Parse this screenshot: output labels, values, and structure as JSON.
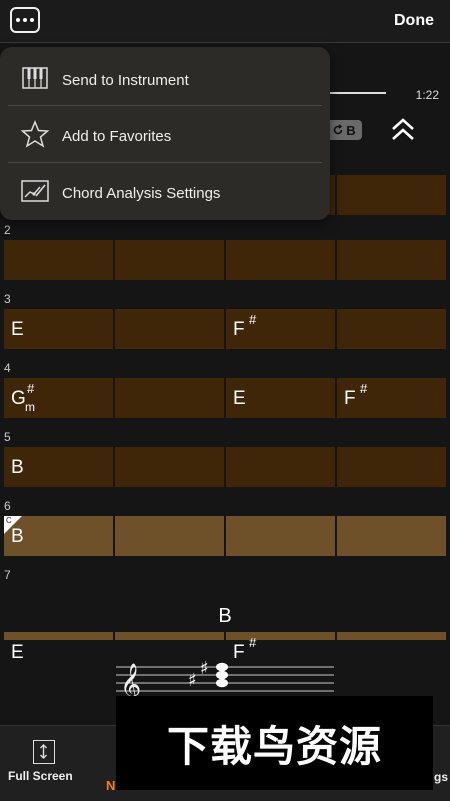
{
  "header": {
    "done_label": "Done",
    "time": "1:22",
    "key_label": "B"
  },
  "menu": {
    "items": [
      {
        "label": "Send to Instrument",
        "icon": "piano-keyboard-icon"
      },
      {
        "label": "Add to Favorites",
        "icon": "star-icon"
      },
      {
        "label": "Chord Analysis Settings",
        "icon": "chord-analysis-settings-icon"
      }
    ]
  },
  "chart": {
    "row_numbers": [
      "2",
      "3",
      "4",
      "5",
      "6",
      "7"
    ],
    "rows": [
      {
        "chords": [
          "",
          "",
          "",
          ""
        ]
      },
      {
        "chords": [
          "E",
          "",
          "F",
          ""
        ],
        "sharps": [
          false,
          false,
          true,
          false
        ]
      },
      {
        "chords": [
          "G",
          "",
          "E",
          "F"
        ],
        "sharps": [
          true,
          false,
          false,
          true
        ],
        "minor": [
          true,
          false,
          false,
          false
        ]
      },
      {
        "chords": [
          "B",
          "",
          "",
          ""
        ]
      },
      {
        "chords": [
          "B",
          "",
          "",
          ""
        ],
        "marker": "C"
      },
      {
        "chords": [
          "E",
          "",
          "F",
          ""
        ],
        "sharps": [
          false,
          false,
          true,
          false
        ]
      }
    ],
    "sharp_symbol": "#",
    "minor_symbol": "m",
    "colors": {
      "dark_cell": "#3f2608",
      "light_cell": "#6e5128"
    }
  },
  "current_chord": "B",
  "bottom": {
    "full_screen_label": "Full Screen",
    "n_label": "N",
    "settings_label": "gs"
  },
  "watermark": "下载鸟资源"
}
